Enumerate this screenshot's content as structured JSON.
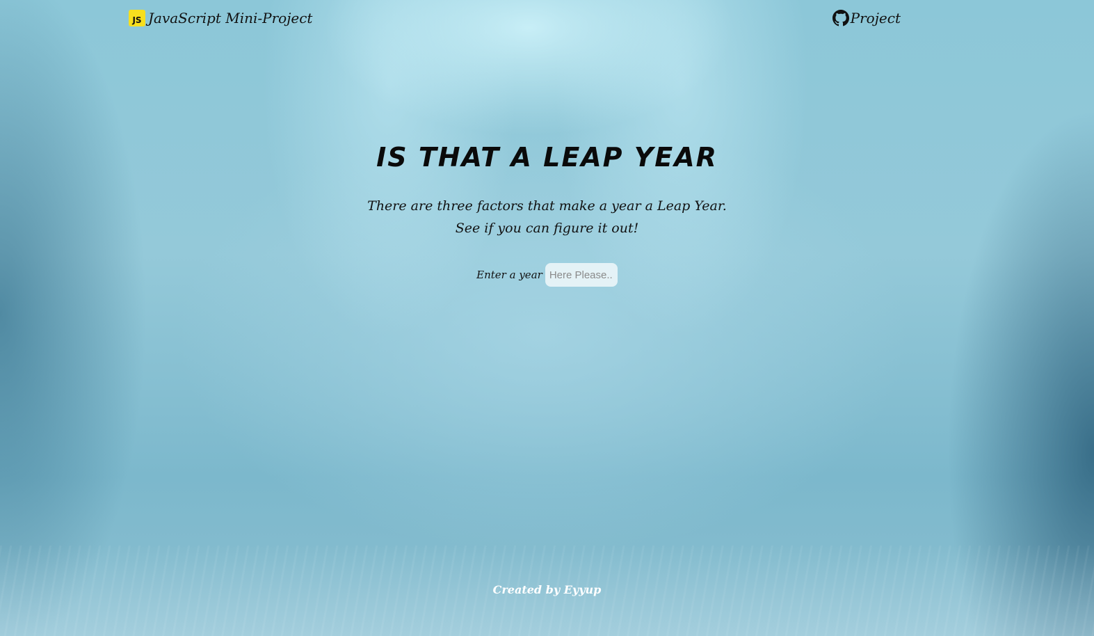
{
  "header": {
    "brand_badge": "JS",
    "brand_title": "JavaScript Mini-Project",
    "project_link_label": "Project",
    "project_icon": "github-icon"
  },
  "main": {
    "title": "IS THAT A LEAP YEAR",
    "description_line1": "There are three factors that make a year a Leap Year.",
    "description_line2": "See if you can figure it out!",
    "year_label": "Enter a year",
    "year_input": {
      "value": "",
      "placeholder": "Here Please..."
    }
  },
  "footer": {
    "credit": "Created by Eyyup"
  },
  "colors": {
    "js_badge": "#f7df1e",
    "background": "#8cc7d8",
    "footer_text": "#ffffff"
  }
}
